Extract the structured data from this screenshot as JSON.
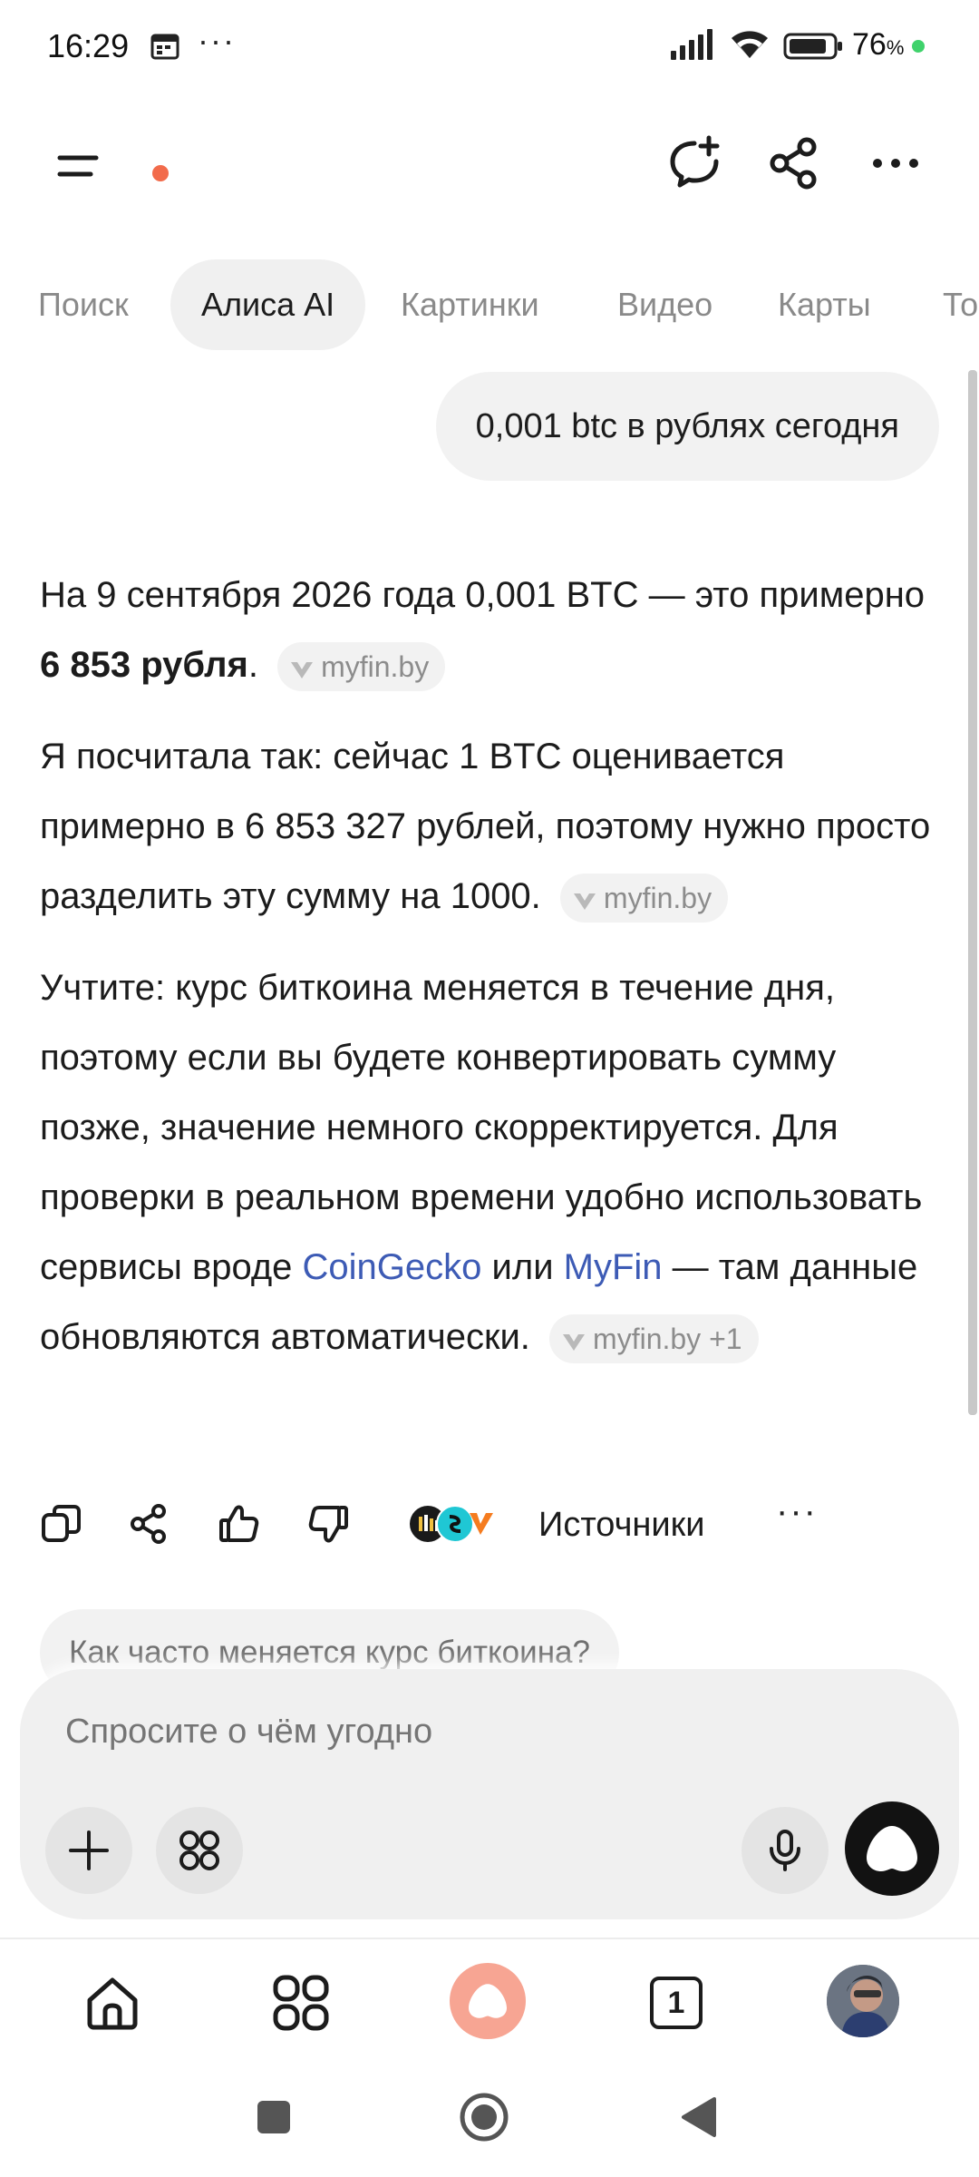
{
  "status_bar": {
    "time": "16:29",
    "dots": "···",
    "battery_value": "76",
    "battery_unit": "%"
  },
  "tabs": [
    "Поиск",
    "Алиса AI",
    "Картинки",
    "Видео",
    "Карты",
    "То"
  ],
  "active_tab_index": 1,
  "query": "0,001 btc в рублях сегодня",
  "answer": {
    "p1_a": "На 9 сентября 2026 года 0,001 BTC — это примерно ",
    "p1_bold": "6 853 рубля",
    "p1_b": ".",
    "p1_source": "myfin.by",
    "p2": "Я посчитала так: сейчас 1 BTC оценивается примерно в 6 853 327 рублей, поэтому нужно просто разделить эту сумму на 1000.",
    "p2_source": "myfin.by",
    "p3_a": "Учтите: курс биткоина меняется в течение дня, поэтому если вы будете конвертировать сумму позже, значение немного скорректируется. Для проверки в реальном времени удобно использовать сервисы вроде ",
    "p3_link1": "CoinGecko",
    "p3_b": " или ",
    "p3_link2": "MyFin",
    "p3_c": " — там данные обновляются автоматически.",
    "p3_source": "myfin.by +1"
  },
  "actions": {
    "sources_label": "Источники",
    "more": "···"
  },
  "suggestion": "Как часто меняется курс биткоина?",
  "input": {
    "placeholder": "Спросите о чём угодно"
  },
  "bottom_nav": {
    "tab_count": "1"
  },
  "colors": {
    "accent_link": "#3d5bb5",
    "alice_coral": "#f7a593",
    "notification_dot": "#f26b4b",
    "online_dot": "#3fd26b"
  }
}
